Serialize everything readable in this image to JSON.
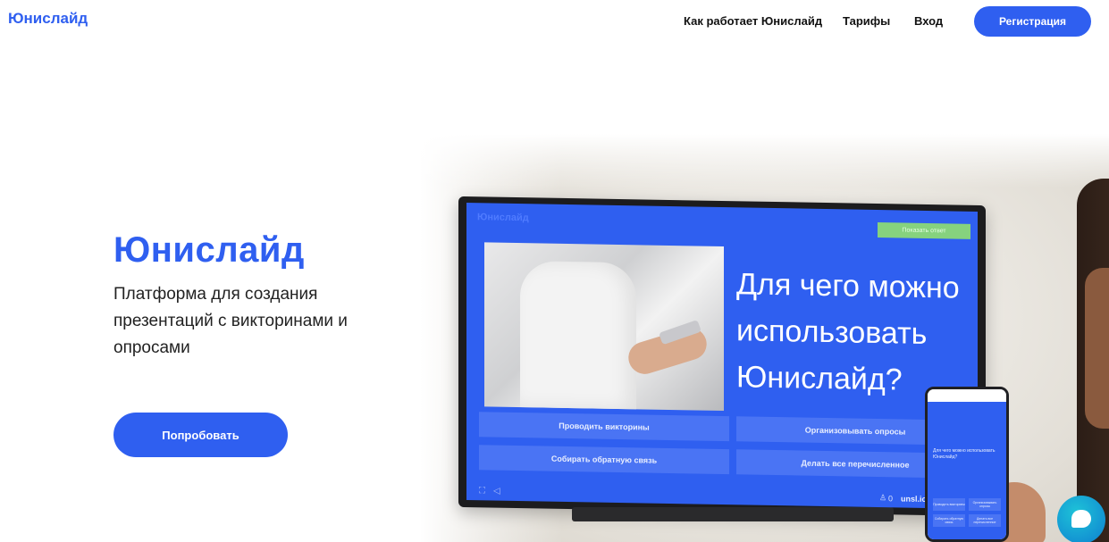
{
  "header": {
    "logo": "Юнислайд",
    "nav": {
      "how_it_works": "Как работает Юнислайд",
      "tariffs": "Тарифы",
      "login": "Вход"
    },
    "register_label": "Регистрация"
  },
  "hero": {
    "title": "Юнислайд",
    "subtitle": "Платформа для создания презентаций с викторинами и опросами",
    "cta_label": "Попробовать"
  },
  "tv_screen": {
    "logo": "Юнислайд",
    "show_button": "Показать ответ",
    "question": "Для чего можно использовать Юнислайд?",
    "options": [
      "Проводить викторины",
      "Организовывать опросы",
      "Собирать обратную связь",
      "Делать все перечисленное"
    ],
    "participants": "0",
    "url": "unsl.io"
  },
  "phone": {
    "question": "Для чего можно использовать Юнислайд?",
    "options": [
      "Проводить викторины",
      "Организовывать опросы",
      "Собирать обратную связь",
      "Делать все перечисленное"
    ]
  },
  "icons": {
    "chat": "chat-bubble-icon",
    "fullscreen": "fullscreen-icon",
    "sound": "sound-icon",
    "participants": "person-icon"
  },
  "colors": {
    "brand": "#2f5ff0",
    "option": "#4a74f4",
    "show_answer": "#86d27e",
    "chat": "#1ec3d8"
  }
}
